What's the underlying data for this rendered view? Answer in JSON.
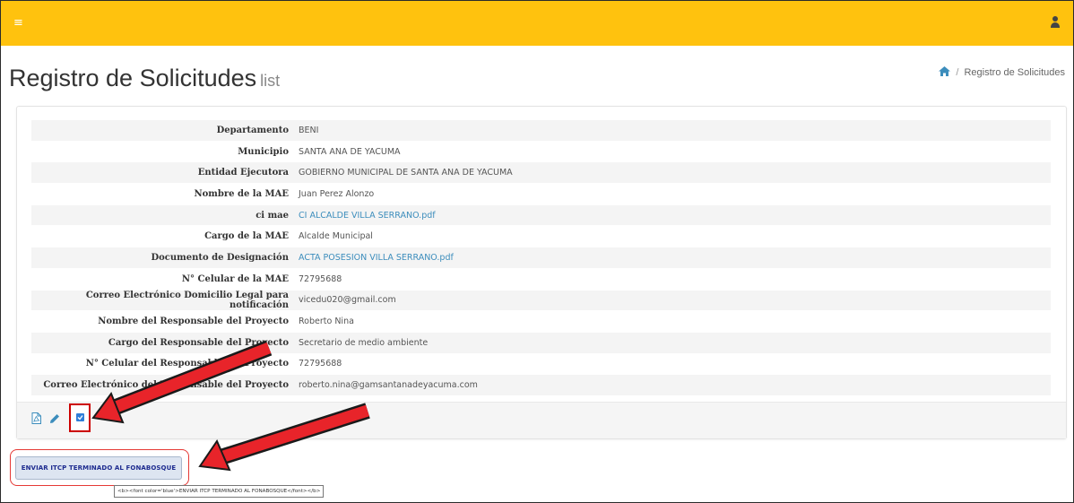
{
  "header": {
    "menu_icon": "hamburger-icon",
    "user_icon": "user-icon",
    "bar_color": "#ffc20e"
  },
  "page": {
    "title": "Registro de Solicitudes",
    "subtitle": "list"
  },
  "breadcrumb": {
    "home_icon": "home-icon",
    "current": "Registro de Solicitudes"
  },
  "details": {
    "rows": [
      {
        "label": "Departamento",
        "value": "BENI",
        "is_link": false
      },
      {
        "label": "Municipio",
        "value": "SANTA ANA DE YACUMA",
        "is_link": false
      },
      {
        "label": "Entidad Ejecutora",
        "value": "GOBIERNO MUNICIPAL DE SANTA ANA DE YACUMA",
        "is_link": false
      },
      {
        "label": "Nombre de la MAE",
        "value": "Juan Perez Alonzo",
        "is_link": false
      },
      {
        "label": "ci mae",
        "value": "CI ALCALDE VILLA SERRANO.pdf",
        "is_link": true
      },
      {
        "label": "Cargo de la MAE",
        "value": "Alcalde Municipal",
        "is_link": false
      },
      {
        "label": "Documento de Designación",
        "value": "ACTA POSESION VILLA SERRANO.pdf",
        "is_link": true
      },
      {
        "label": "N° Celular de la MAE",
        "value": "72795688",
        "is_link": false
      },
      {
        "label": "Correo Electrónico Domicilio Legal para notificación",
        "value": "vicedu020@gmail.com",
        "is_link": false
      },
      {
        "label": "Nombre del Responsable del Proyecto",
        "value": "Roberto Nina",
        "is_link": false
      },
      {
        "label": "Cargo del Responsable del Proyecto",
        "value": "Secretario de medio ambiente",
        "is_link": false
      },
      {
        "label": "N° Celular del Responsable del Proyecto",
        "value": "72795688",
        "is_link": false
      },
      {
        "label": "Correo Electrónico del Responsable del Proyecto",
        "value": "roberto.nina@gamsantanadeyacuma.com",
        "is_link": false
      }
    ]
  },
  "actions": {
    "pdf_icon": "pdf-icon",
    "edit_icon": "pencil-icon",
    "check_icon": "checkbox-icon",
    "send_button_label": "ENVIAR ITCP TERMINADO AL FONABOSQUE",
    "tooltip": "<b><font color='blue'>ENVIAR ITCP TERMINADO AL FONABOSQUE</font></b>"
  },
  "annotations": {
    "arrow_color": "#e8242a",
    "highlight_color": "#cc0000"
  }
}
